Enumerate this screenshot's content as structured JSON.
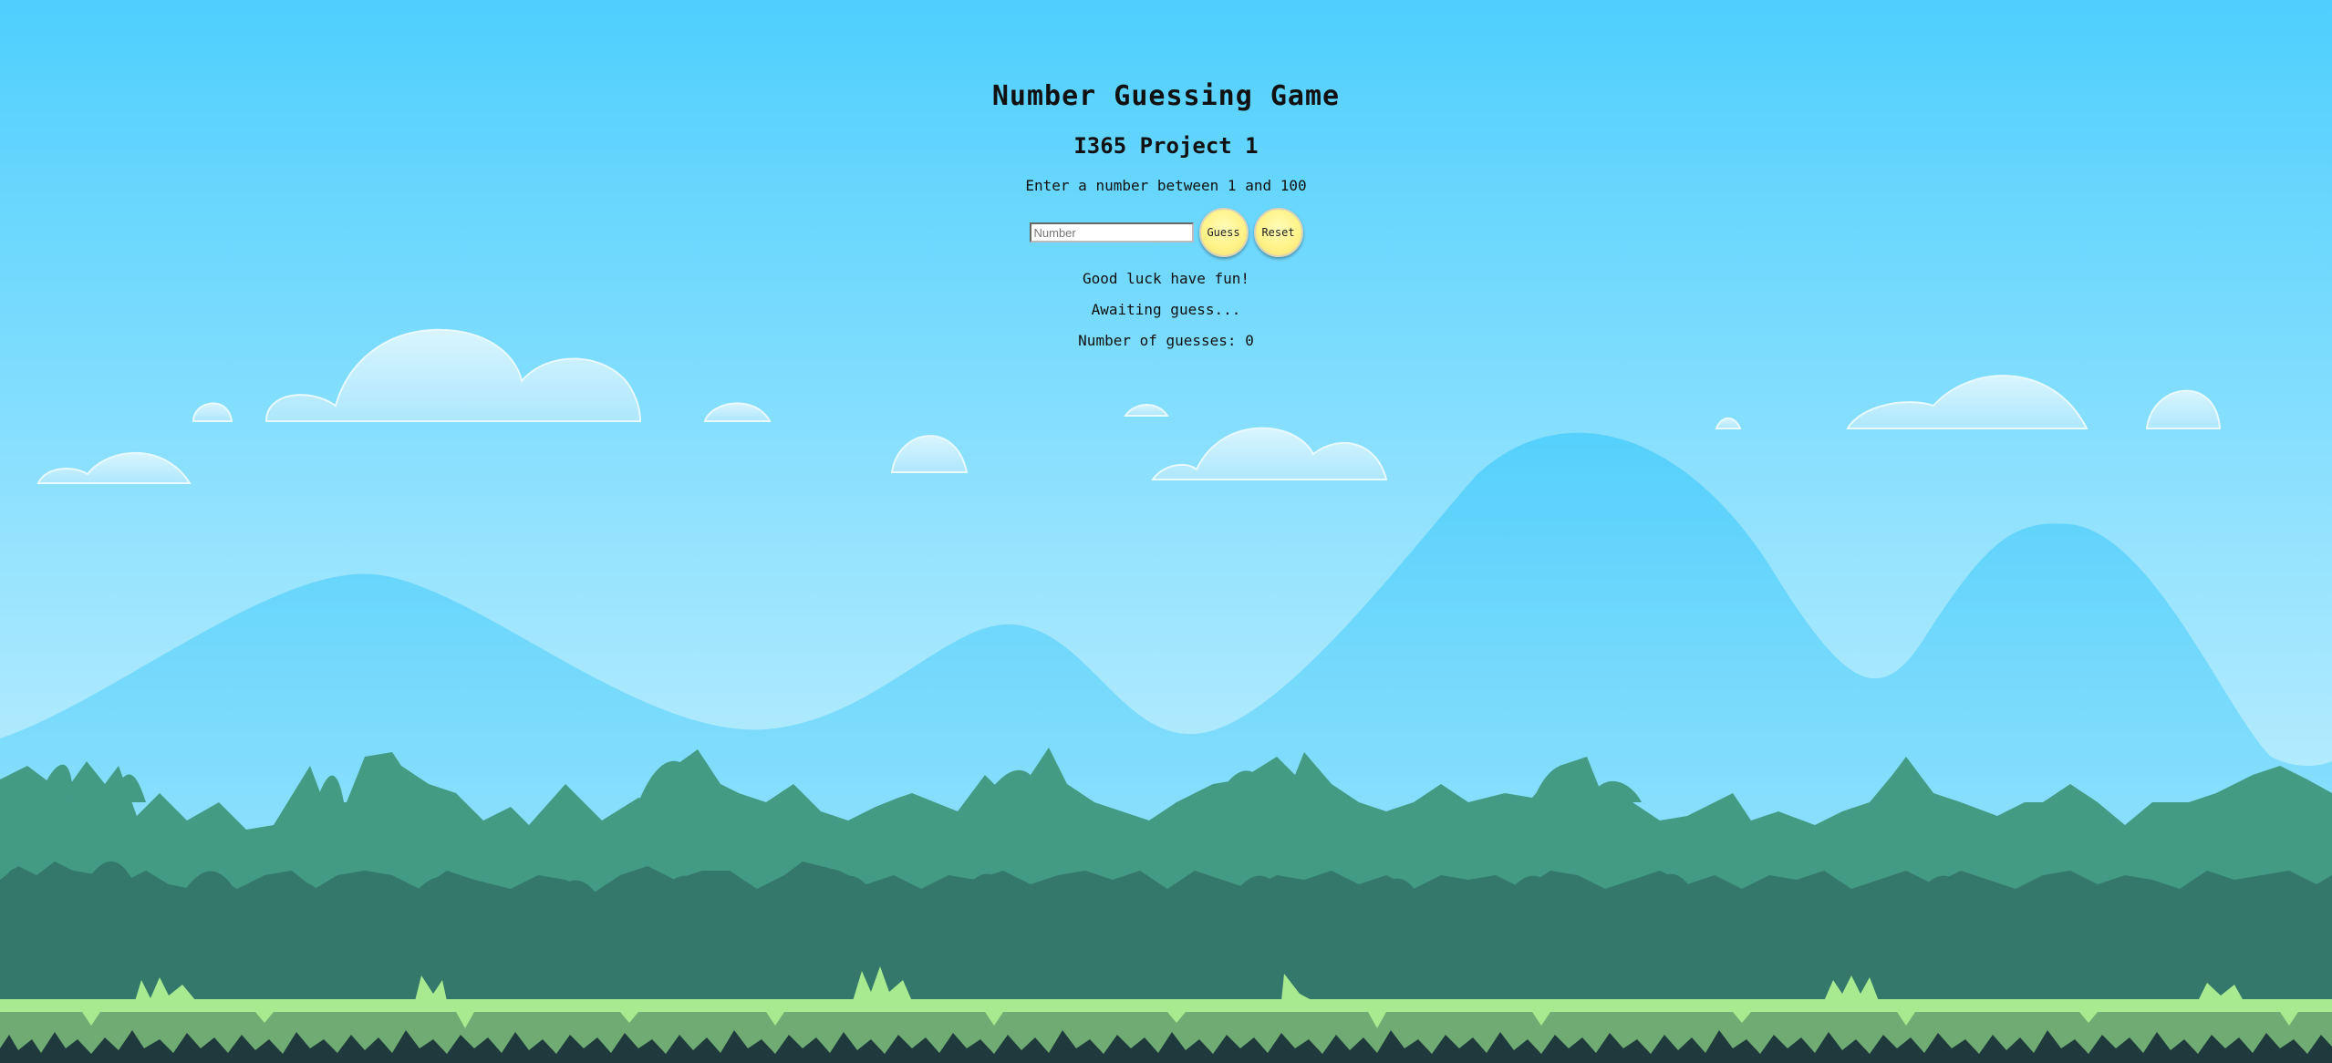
{
  "game": {
    "title": "Number Guessing Game",
    "subtitle": "I365 Project 1",
    "instructions": "Enter a number between 1 and 100",
    "input": {
      "placeholder": "Number",
      "value": ""
    },
    "guess_button": "Guess",
    "reset_button": "Reset",
    "message": "Good luck have fun!",
    "status": "Awaiting guess...",
    "guess_count_label": "Number of guesses: 0"
  },
  "colors": {
    "sky_top": "#4ecffd",
    "sky_bottom": "#c8f1fe",
    "mountain": "#5fd3fb",
    "bush_light": "#449b84",
    "bush_dark": "#33786a",
    "grass_light": "#a8ea8f",
    "grass_mid": "#6fab72",
    "soil_dark": "#1f3a3c",
    "button_fill": "#fff38a"
  }
}
